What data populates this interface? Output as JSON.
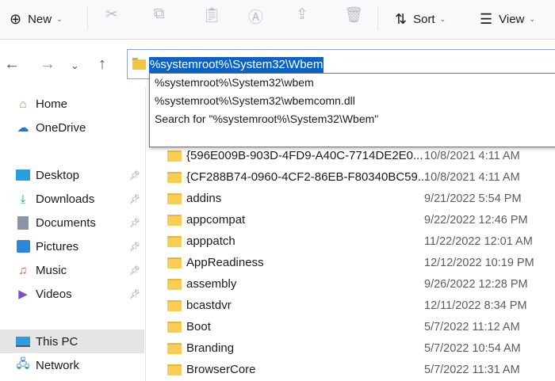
{
  "toolbar": {
    "new_label": "New",
    "sort_label": "Sort",
    "view_label": "View",
    "icons": [
      "plus-circle-icon",
      "cut-icon",
      "copy-icon",
      "paste-icon",
      "rename-icon",
      "share-icon",
      "delete-icon",
      "sort-icon",
      "view-icon"
    ]
  },
  "address": {
    "value": "%systemroot%\\System32\\Wbem",
    "suggestions": [
      "%systemroot%\\System32\\wbem",
      "%systemroot%\\System32\\wbemcomn.dll",
      "Search for \"%systemroot%\\System32\\Wbem\""
    ]
  },
  "sidebar": {
    "items": [
      {
        "label": "Home",
        "icon": "home-icon"
      },
      {
        "label": "OneDrive",
        "icon": "cloud-icon"
      },
      {
        "label": "Desktop",
        "icon": "desktop-icon",
        "pinned": true
      },
      {
        "label": "Downloads",
        "icon": "download-icon",
        "pinned": true
      },
      {
        "label": "Documents",
        "icon": "document-icon",
        "pinned": true
      },
      {
        "label": "Pictures",
        "icon": "pictures-icon",
        "pinned": true
      },
      {
        "label": "Music",
        "icon": "music-icon",
        "pinned": true
      },
      {
        "label": "Videos",
        "icon": "videos-icon",
        "pinned": true
      },
      {
        "label": "This PC",
        "icon": "pc-icon",
        "selected": true
      },
      {
        "label": "Network",
        "icon": "network-icon"
      }
    ]
  },
  "files": [
    {
      "name": "{596E009B-903D-4FD9-A40C-7714DE2E0...",
      "date": "10/8/2021 4:11 AM"
    },
    {
      "name": "{CF288B74-0960-4CF2-86EB-F80340BC59...",
      "date": "10/8/2021 4:11 AM"
    },
    {
      "name": "addins",
      "date": "9/21/2022 5:54 PM"
    },
    {
      "name": "appcompat",
      "date": "9/22/2022 12:46 PM"
    },
    {
      "name": "apppatch",
      "date": "11/22/2022 12:01 AM"
    },
    {
      "name": "AppReadiness",
      "date": "12/12/2022 10:19 PM"
    },
    {
      "name": "assembly",
      "date": "9/26/2022 12:28 PM"
    },
    {
      "name": "bcastdvr",
      "date": "12/11/2022 8:34 PM"
    },
    {
      "name": "Boot",
      "date": "5/7/2022 11:12 AM"
    },
    {
      "name": "Branding",
      "date": "5/7/2022 10:54 AM"
    },
    {
      "name": "BrowserCore",
      "date": "5/7/2022 11:31 AM"
    }
  ]
}
